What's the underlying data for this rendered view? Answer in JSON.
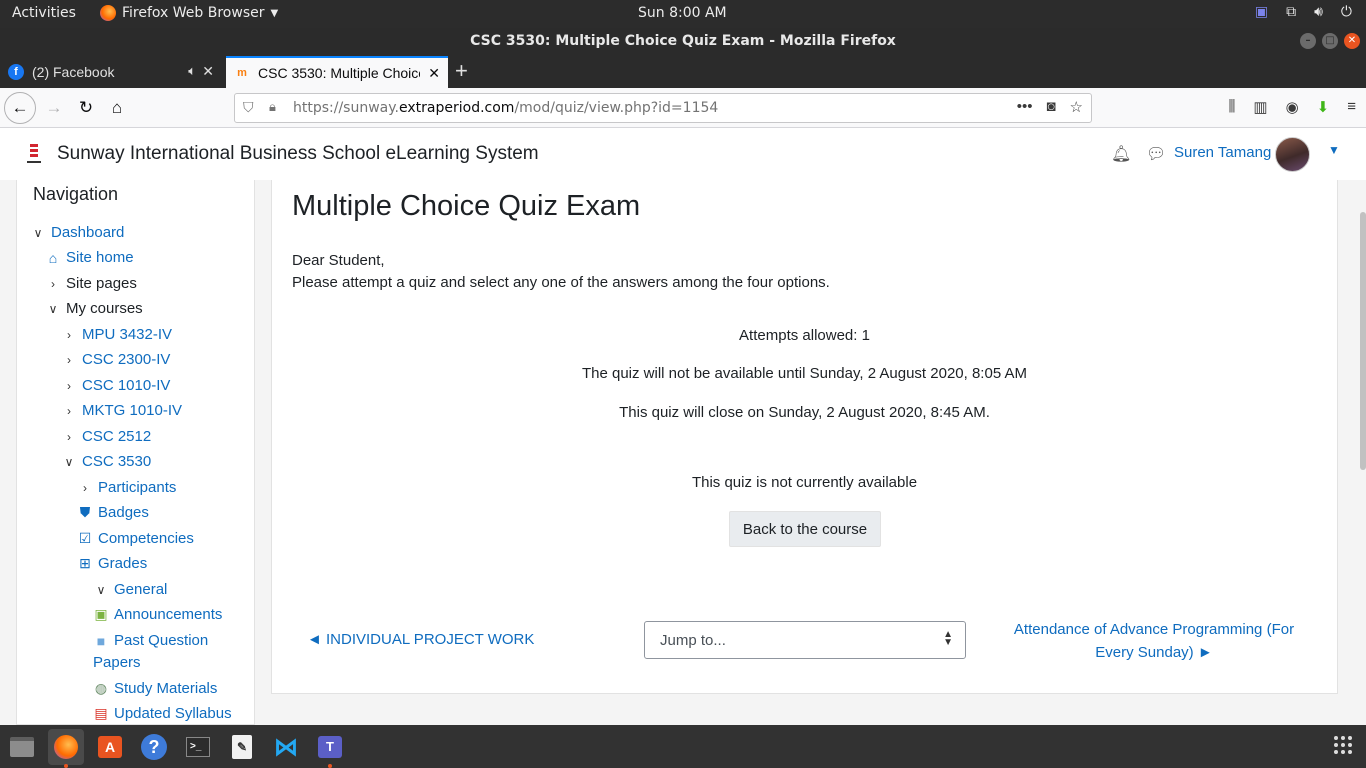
{
  "system": {
    "activities": "Activities",
    "app_menu": "Firefox Web Browser",
    "clock": "Sun  8:00 AM"
  },
  "window": {
    "title": "CSC 3530: Multiple Choice Quiz Exam - Mozilla Firefox"
  },
  "tabs": [
    {
      "title": "(2) Facebook",
      "favicon": "facebook-icon"
    },
    {
      "title": "CSC 3530: Multiple Choice Quiz Exam",
      "favicon": "moodle-icon"
    }
  ],
  "address_bar": {
    "url_prefix": "https://sunway.",
    "url_domain": "extraperiod.com",
    "url_path": "/mod/quiz/view.php?id=1154"
  },
  "site": {
    "name": "Sunway International Business School eLearning System",
    "user_name": "Suren Tamang"
  },
  "nav": {
    "heading": "Navigation",
    "dashboard": "Dashboard",
    "site_home": "Site home",
    "site_pages": "Site pages",
    "my_courses": "My courses",
    "courses": [
      "MPU 3432-IV",
      "CSC 2300-IV",
      "CSC 1010-IV",
      "MKTG 1010-IV",
      "CSC 2512",
      "CSC 3530"
    ],
    "participants": "Participants",
    "badges": "Badges",
    "competencies": "Competencies",
    "grades": "Grades",
    "general": "General",
    "announcements": "Announcements",
    "past_papers_line1": "Past Question",
    "past_papers_line2": "Papers",
    "study_materials": "Study Materials",
    "updated_syllabus": "Updated Syllabus"
  },
  "quiz": {
    "title": "Multiple Choice Quiz Exam",
    "intro_line1": "Dear Student,",
    "intro_line2": "Please attempt a quiz and select any one of the answers among the four options.",
    "attempts": "Attempts allowed: 1",
    "open_info": "The quiz will not be available until Sunday, 2 August 2020, 8:05 AM",
    "close_info": "This quiz will close on Sunday, 2 August 2020, 8:45 AM.",
    "status": "This quiz is not currently available",
    "back_button": "Back to the course"
  },
  "activity_nav": {
    "prev": "◄ INDIVIDUAL PROJECT WORK",
    "jump_placeholder": "Jump to...",
    "next_line1": "Attendance of Advance Programming (For",
    "next_line2": "Every Sunday) ►"
  },
  "colors": {
    "link": "#0f6cbf",
    "ubuntu_orange": "#e95420",
    "firefox_tab_accent": "#0a84ff"
  }
}
